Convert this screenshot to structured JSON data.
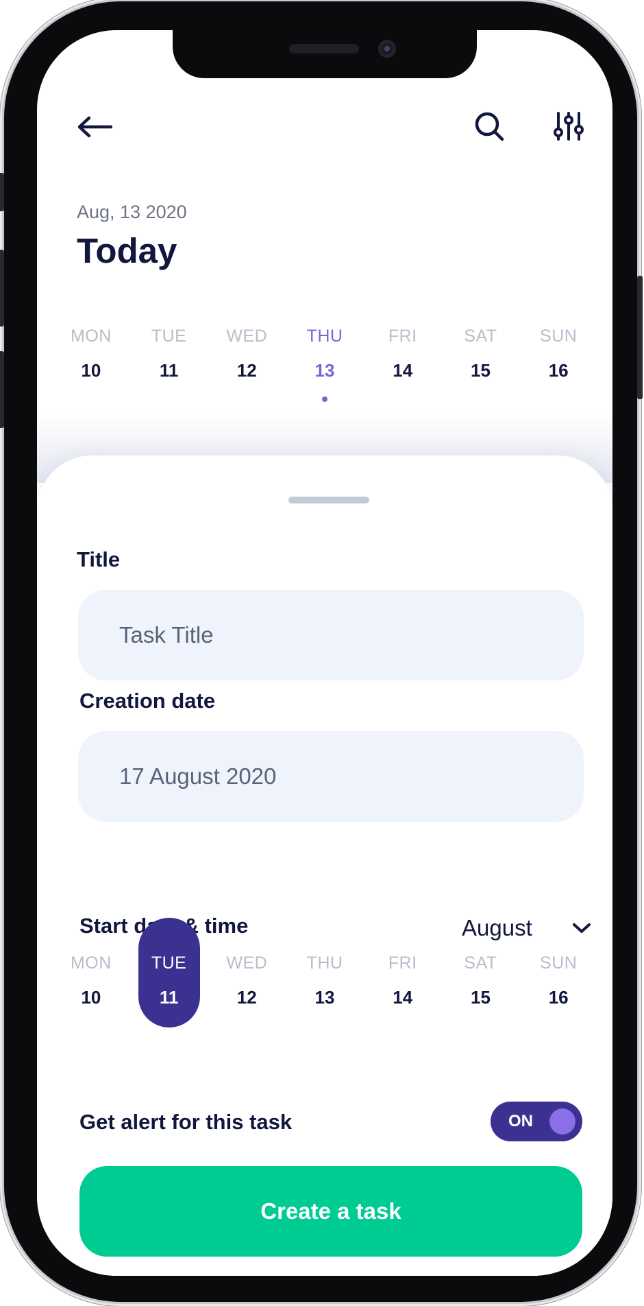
{
  "header": {
    "back_icon": "arrow-left-icon",
    "search_icon": "search-icon",
    "filter_icon": "sliders-icon",
    "date_label": "Aug, 13 2020",
    "title": "Today"
  },
  "top_week": {
    "days": [
      {
        "name": "MON",
        "num": "10"
      },
      {
        "name": "TUE",
        "num": "11"
      },
      {
        "name": "WED",
        "num": "12"
      },
      {
        "name": "THU",
        "num": "13"
      },
      {
        "name": "FRI",
        "num": "14"
      },
      {
        "name": "SAT",
        "num": "15"
      },
      {
        "name": "SUN",
        "num": "16"
      }
    ],
    "active_index": 3
  },
  "form": {
    "title_label": "Title",
    "title_placeholder": "Task Title",
    "creation_label": "Creation date",
    "creation_value": "17 August 2020",
    "start_label": "Start date & time",
    "month_value": "August"
  },
  "bottom_week": {
    "days": [
      {
        "name": "MON",
        "num": "10"
      },
      {
        "name": "TUE",
        "num": "11"
      },
      {
        "name": "WED",
        "num": "12"
      },
      {
        "name": "THU",
        "num": "13"
      },
      {
        "name": "FRI",
        "num": "14"
      },
      {
        "name": "SAT",
        "num": "15"
      },
      {
        "name": "SUN",
        "num": "16"
      }
    ],
    "active_index": 1
  },
  "alert": {
    "label": "Get alert for this task",
    "toggle_label": "ON"
  },
  "actions": {
    "create_label": "Create a task"
  },
  "colors": {
    "primary": "#3b3191",
    "accent": "#7e63d7",
    "success": "#00cb93",
    "text": "#13173d",
    "input_bg": "#eff3fc"
  }
}
